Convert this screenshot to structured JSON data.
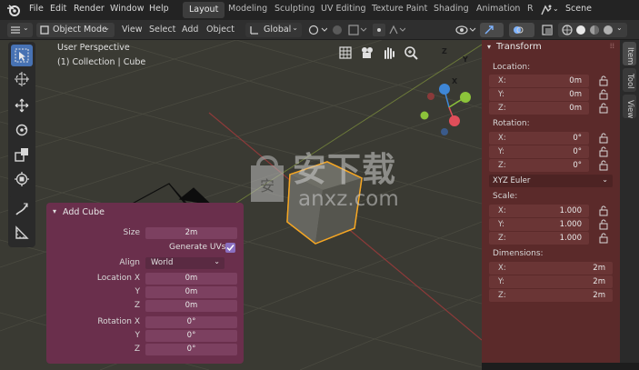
{
  "menubar": {
    "items": [
      "File",
      "Edit",
      "Render",
      "Window",
      "Help"
    ],
    "workspace_tabs": [
      "Layout",
      "Modeling",
      "Sculpting",
      "UV Editing",
      "Texture Paint",
      "Shading",
      "Animation",
      "R"
    ],
    "active_tab": "Layout",
    "scene_label": "Scene"
  },
  "header": {
    "mode": "Object Mode",
    "menus": [
      "View",
      "Select",
      "Add",
      "Object"
    ],
    "orientation": "Global"
  },
  "viewport": {
    "perspective_label": "User Perspective",
    "collection_label": "(1) Collection | Cube",
    "watermark_cn": "安下载",
    "watermark_url": "anxz.com",
    "gizmo_axes": [
      "Z",
      "Y",
      "X"
    ]
  },
  "transform_panel": {
    "title": "Transform",
    "location_label": "Location:",
    "location": [
      {
        "axis": "X:",
        "value": "0m"
      },
      {
        "axis": "Y:",
        "value": "0m"
      },
      {
        "axis": "Z:",
        "value": "0m"
      }
    ],
    "rotation_label": "Rotation:",
    "rotation": [
      {
        "axis": "X:",
        "value": "0°"
      },
      {
        "axis": "Y:",
        "value": "0°"
      },
      {
        "axis": "Z:",
        "value": "0°"
      }
    ],
    "rotation_mode": "XYZ Euler",
    "scale_label": "Scale:",
    "scale": [
      {
        "axis": "X:",
        "value": "1.000"
      },
      {
        "axis": "Y:",
        "value": "1.000"
      },
      {
        "axis": "Z:",
        "value": "1.000"
      }
    ],
    "dimensions_label": "Dimensions:",
    "dimensions": [
      {
        "axis": "X:",
        "value": "2m"
      },
      {
        "axis": "Y:",
        "value": "2m"
      },
      {
        "axis": "Z:",
        "value": "2m"
      }
    ]
  },
  "side_tabs": [
    "Item",
    "Tool",
    "View"
  ],
  "add_cube": {
    "title": "Add Cube",
    "size_label": "Size",
    "size_value": "2m",
    "generate_uvs_label": "Generate UVs",
    "generate_uvs": true,
    "align_label": "Align",
    "align_value": "World",
    "location_label": "Location X",
    "location_values": [
      "0m",
      "0m",
      "0m"
    ],
    "rotation_label": "Rotation X",
    "rotation_values": [
      "0°",
      "0°",
      "0°"
    ],
    "y_label": "Y",
    "z_label": "Z"
  },
  "colors": {
    "accent": "#4772b3",
    "n_panel": "#5b2a2a",
    "redo_panel": "#6a2f4c",
    "selection_outline": "#f5a623",
    "axis_x": "#e04e5a",
    "axis_y": "#8cc43a",
    "axis_z": "#3e86d6"
  }
}
